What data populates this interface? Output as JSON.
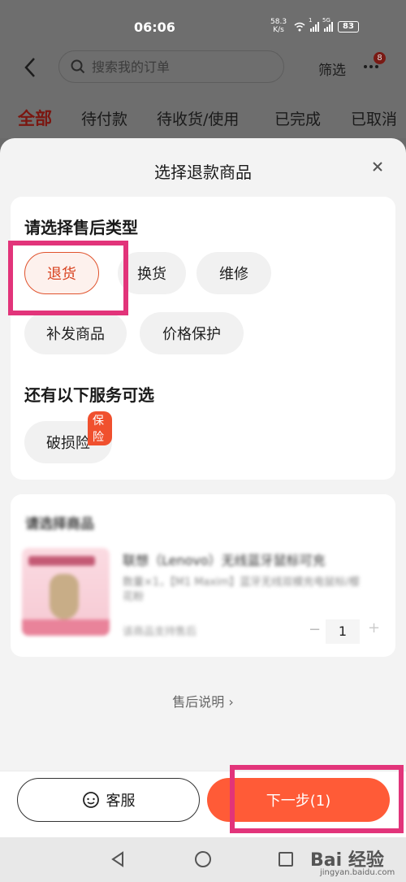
{
  "status_bar": {
    "time": "06:06",
    "net_speed": "58.3",
    "net_unit": "K/s",
    "sig1_label": "1",
    "sig2_label": "5G",
    "battery": "83"
  },
  "header": {
    "search_placeholder": "搜索我的订单",
    "filter_label": "筛选",
    "more_badge": "8"
  },
  "tabs": [
    {
      "label": "全部",
      "active": true
    },
    {
      "label": "待付款"
    },
    {
      "label": "待收货/使用"
    },
    {
      "label": "已完成"
    },
    {
      "label": "已取消"
    }
  ],
  "sheet": {
    "title": "选择退款商品",
    "type_section_title": "请选择售后类型",
    "types": [
      "退货",
      "换货",
      "维修",
      "补发商品",
      "价格保护"
    ],
    "selected_type": "退货",
    "extra_section_title": "还有以下服务可选",
    "extra_service": "破损险",
    "extra_tag": "保险",
    "product_section_title": "请选择商品",
    "product_name": "联想（Lenovo）无线蓝牙鼠标可充",
    "product_spec": "数量×1，【M1 Maxim】蓝牙无线双模充电鼠标/樱花粉",
    "product_sub": "该商品支持售后",
    "quantity": "1",
    "quantity_minus": "−",
    "quantity_plus": "+",
    "aftersale_note": "售后说明",
    "aftersale_arrow": "›"
  },
  "footer": {
    "service_label": "客服",
    "next_label": "下一步(1)"
  },
  "watermark": {
    "brand": "Bai 经验",
    "url": "jingyan.baidu.com"
  },
  "colors": {
    "accent": "#ff5b37",
    "selected_border": "#e0532d",
    "highlight": "#e2347a"
  }
}
